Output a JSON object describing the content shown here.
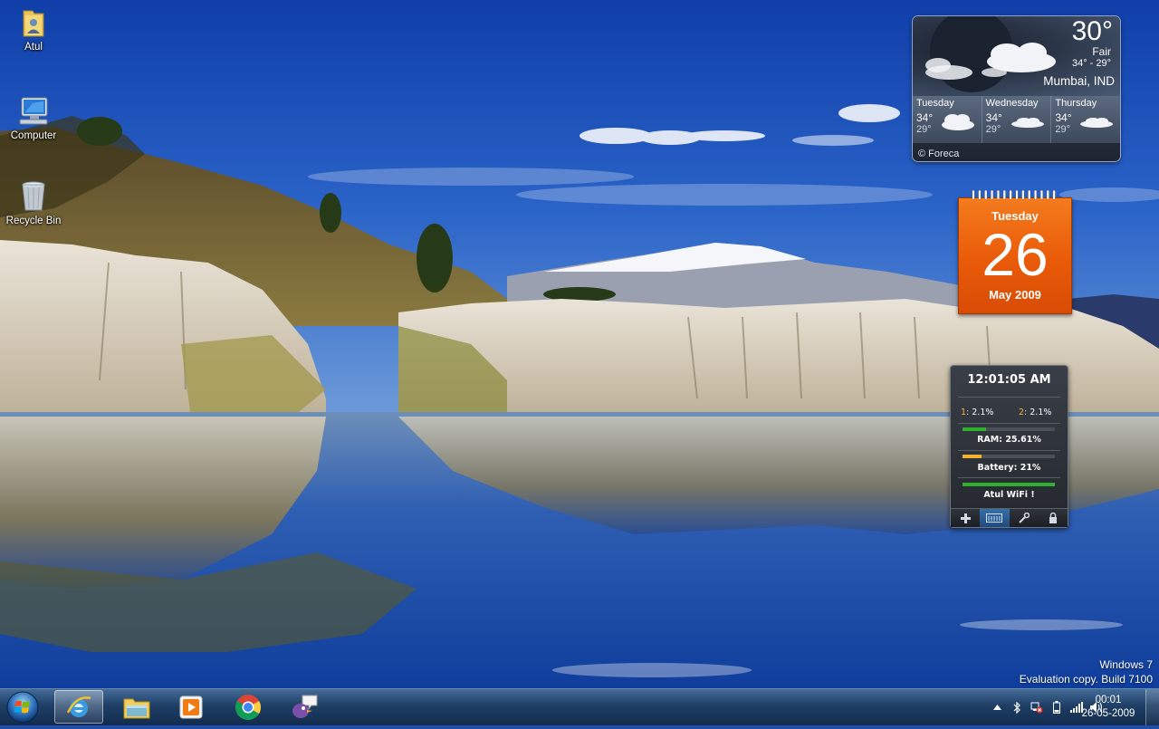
{
  "desktop": {
    "icons": [
      {
        "label": "Atul",
        "icon": "user-folder-icon"
      },
      {
        "label": "Computer",
        "icon": "computer-icon"
      },
      {
        "label": "Recycle Bin",
        "icon": "recycle-bin-icon"
      }
    ]
  },
  "weather": {
    "temp": "30°",
    "condition": "Fair",
    "range": "34°  -  29°",
    "city": "Mumbai, IND",
    "days": [
      {
        "name": "Tuesday",
        "hi": "34°",
        "lo": "29°"
      },
      {
        "name": "Wednesday",
        "hi": "34°",
        "lo": "29°"
      },
      {
        "name": "Thursday",
        "hi": "34°",
        "lo": "29°"
      }
    ],
    "credit": "© Foreca"
  },
  "calendar": {
    "weekday": "Tuesday",
    "day": "26",
    "month_year": "May 2009"
  },
  "sysmon": {
    "clock": "12:01:05 AM",
    "cpu1_label": "1",
    "cpu1_value": ": 2.1%",
    "cpu2_label": "2",
    "cpu2_value": ": 2.1%",
    "ram_label": "RAM: 25.61%",
    "ram_fraction": 0.2561,
    "battery_label": "Battery: 21%",
    "battery_fraction": 0.21,
    "wifi_label": "Atul WiFi !",
    "wifi_fraction": 1.0,
    "tools": [
      "plus-icon",
      "monitor-icon",
      "wrench-icon",
      "lock-icon"
    ]
  },
  "watermark": {
    "line1": "Windows 7",
    "line2": "Evaluation copy. Build 7100"
  },
  "taskbar": {
    "start_icon": "windows-start-orb-icon",
    "pinned": [
      "internet-explorer-icon",
      "windows-explorer-icon",
      "media-player-icon",
      "chrome-icon",
      "pidgin-icon"
    ],
    "tray_icons": [
      "show-hidden-icons-arrow",
      "bluetooth-icon",
      "network-disconnected-icon",
      "battery-icon",
      "signal-icon",
      "volume-icon"
    ],
    "time": "00:01",
    "date": "26-05-2009"
  },
  "colors": {
    "calendar_orange": "#e95a08",
    "ram_bar": "#2fb12f",
    "battery_bar": "#f2b12f",
    "wifi_bar": "#2fb12f"
  }
}
